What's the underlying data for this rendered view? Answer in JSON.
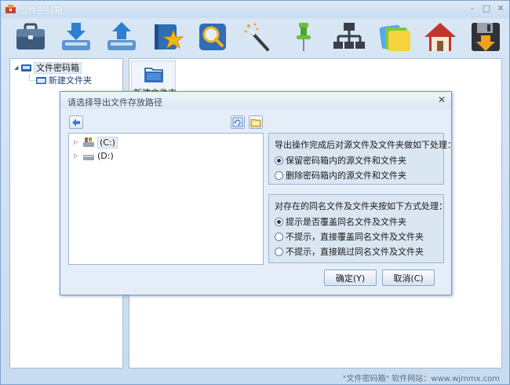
{
  "app": {
    "title": "文件密码箱"
  },
  "window_controls": {
    "minimize": "-",
    "maximize": "□",
    "close": "✕"
  },
  "toolbar": {
    "buttons": [
      {
        "icon": "briefcase-icon"
      },
      {
        "icon": "import-icon"
      },
      {
        "icon": "export-icon"
      },
      {
        "icon": "star-notebook-icon"
      },
      {
        "icon": "magnifier-icon"
      },
      {
        "icon": "magic-wand-icon"
      },
      {
        "icon": "pushpin-icon"
      },
      {
        "icon": "network-icon"
      },
      {
        "icon": "folders-icon"
      },
      {
        "icon": "home-icon"
      },
      {
        "icon": "save-disk-icon"
      }
    ]
  },
  "tree": {
    "root_label": "文件密码箱",
    "child_label": "新建文件夹"
  },
  "file_pane": {
    "folder_label": "新建文件夹"
  },
  "status": {
    "text": "\"文件密码箱\" 软件网站：www.wjmmx.com"
  },
  "dialog": {
    "title": "请选择导出文件存放路径",
    "close_label": "✕",
    "drives": [
      {
        "label": "(C:)",
        "selected": true
      },
      {
        "label": "(D:)",
        "selected": false
      }
    ],
    "group1": {
      "title": "导出操作完成后对源文件及文件夹做如下处理：",
      "options": [
        {
          "label": "保留密码箱内的源文件和文件夹",
          "checked": true
        },
        {
          "label": "删除密码箱内的源文件和文件夹",
          "checked": false
        }
      ]
    },
    "group2": {
      "title": "对存在的同名文件及文件夹按如下方式处理：",
      "options": [
        {
          "label": "提示是否覆盖同名文件及文件夹",
          "checked": true
        },
        {
          "label": "不提示，直接覆盖同名文件及文件夹",
          "checked": false
        },
        {
          "label": "不提示，直接跳过同名文件及文件夹",
          "checked": false
        }
      ]
    },
    "ok_label": "确定(Y)",
    "cancel_label": "取消(C)"
  },
  "colors": {
    "window_frame": "#c8dbef",
    "dialog_bg": "#e5eef8",
    "group_bg": "#dbe6f3",
    "border_blue": "#9cb4d1"
  }
}
